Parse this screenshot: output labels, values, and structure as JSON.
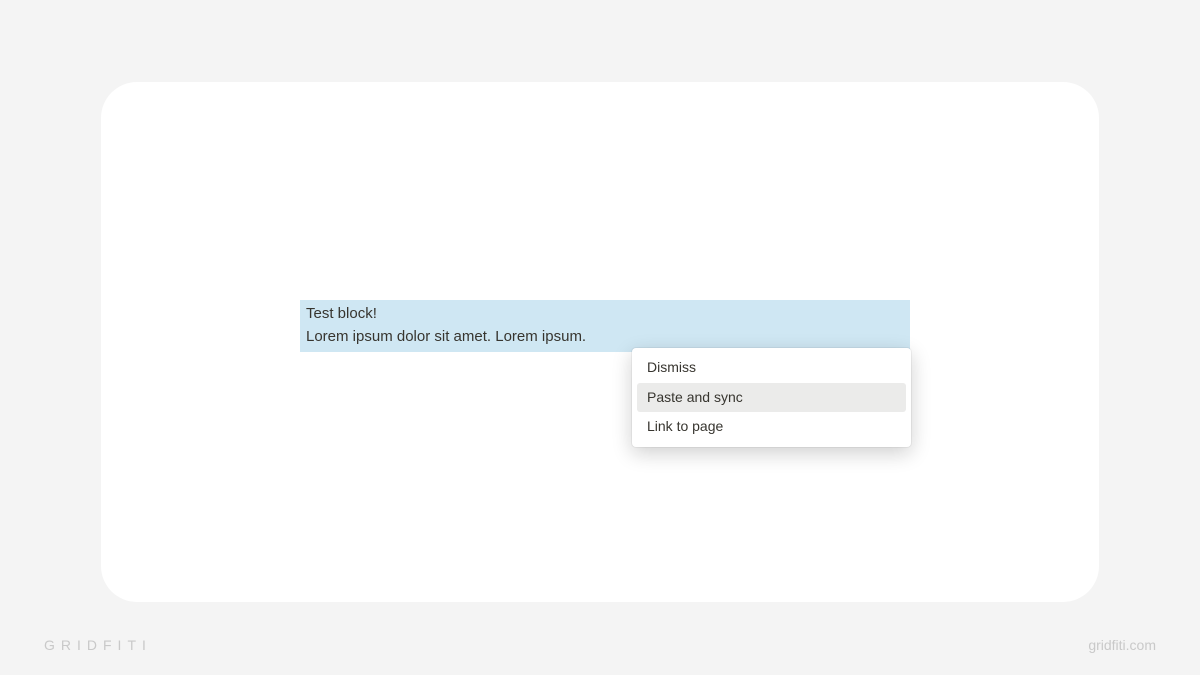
{
  "block": {
    "line1": "Test block!",
    "line2": "Lorem ipsum dolor sit amet. Lorem ipsum."
  },
  "menu": {
    "items": [
      {
        "label": "Dismiss",
        "hovered": false
      },
      {
        "label": "Paste and sync",
        "hovered": true
      },
      {
        "label": "Link to page",
        "hovered": false
      }
    ]
  },
  "watermark": {
    "left": "GRIDFITI",
    "right": "gridfiti.com"
  }
}
